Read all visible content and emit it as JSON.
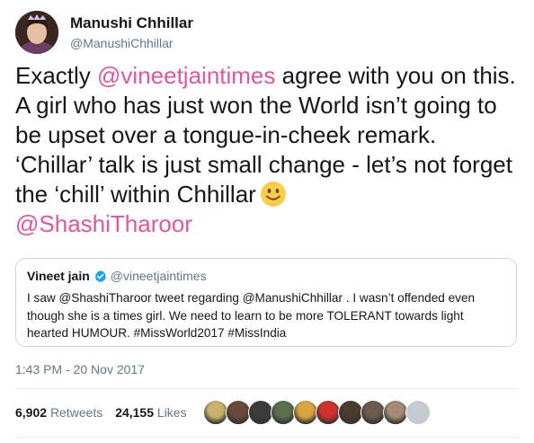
{
  "author": {
    "name": "Manushi Chhillar",
    "handle": "@ManushiChhillar"
  },
  "tweet": {
    "segments": [
      {
        "text": "Exactly ",
        "type": "text"
      },
      {
        "text": "@vineetjaintimes",
        "type": "mention"
      },
      {
        "text": " agree with you on this. A girl who has just won the World isn’t going to be upset over a tongue-in-cheek remark. ‘Chillar’ talk is just small change - let’s not forget the ‘chill’ within Chhillar",
        "type": "text"
      },
      {
        "text": "@ShashiTharoor",
        "type": "mention"
      }
    ],
    "emoji": "slightly-smiling-face-icon"
  },
  "quote": {
    "name": "Vineet jain",
    "handle": "@vineetjaintimes",
    "body": "I saw @ShashiTharoor tweet regarding @ManushiChhillar . I wasn’t offended even though she is a times girl. We need to learn to be more TOLERANT towards light hearted HUMOUR. #MissWorld2017 #MissIndia"
  },
  "timestamp": "1:43 PM - 20 Nov 2017",
  "stats": {
    "retweets_count": "6,902",
    "retweets_label": "Retweets",
    "likes_count": "24,155",
    "likes_label": "Likes"
  },
  "likers": [
    {
      "icon": "liker-avatar-icon",
      "color": "#c9b26d"
    },
    {
      "icon": "liker-avatar-icon",
      "color": "#6b4a3a"
    },
    {
      "icon": "liker-avatar-icon",
      "color": "#3b3b3b"
    },
    {
      "icon": "liker-avatar-icon",
      "color": "#5b6e4a"
    },
    {
      "icon": "liker-avatar-icon",
      "color": "#d9a441"
    },
    {
      "icon": "liker-avatar-icon",
      "color": "#d0312d"
    },
    {
      "icon": "liker-avatar-icon",
      "color": "#4b3a2e"
    },
    {
      "icon": "liker-avatar-icon",
      "color": "#6d5a4b"
    },
    {
      "icon": "liker-avatar-icon",
      "color": "#a38c73"
    },
    {
      "icon": "liker-avatar-icon",
      "color": "#c5cbd1"
    }
  ],
  "colors": {
    "mention": "#e0569f",
    "secondary_text": "#657786",
    "verified": "#1da1f2"
  }
}
